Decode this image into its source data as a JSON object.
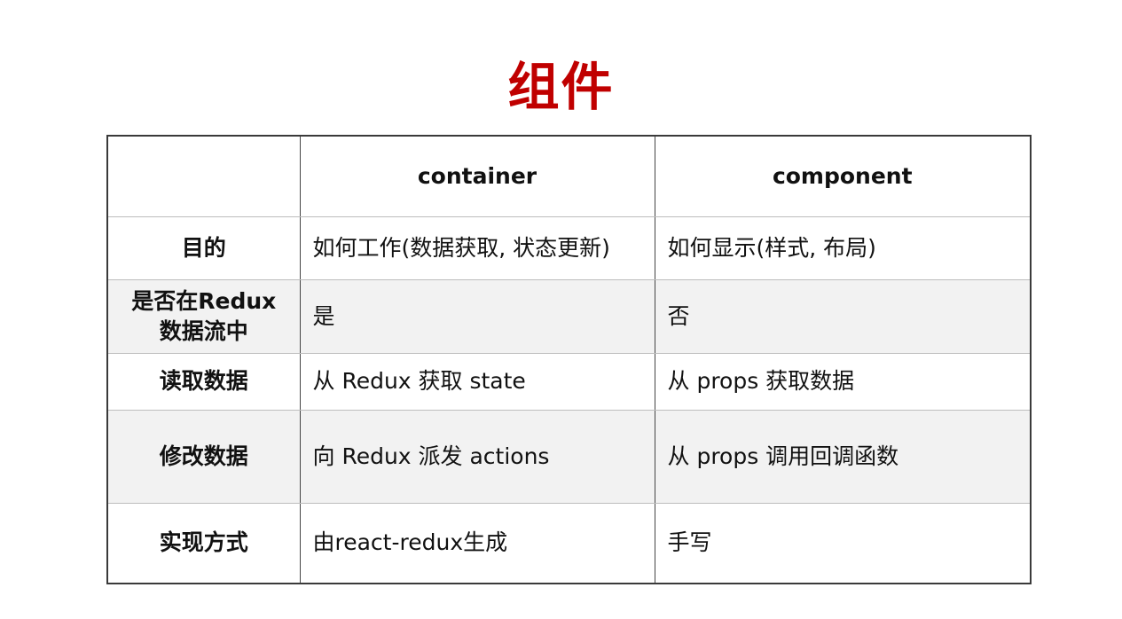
{
  "title": "组件",
  "table": {
    "headers": [
      "",
      "container",
      "component"
    ],
    "rows": [
      {
        "label": "目的",
        "container": "如何工作(数据获取, 状态更新)",
        "component": "如何显示(样式, 布局)"
      },
      {
        "label": "是否在Redux数据流中",
        "container": "是",
        "component": "否"
      },
      {
        "label": "读取数据",
        "container": "从 Redux 获取 state",
        "component": "从 props 获取数据"
      },
      {
        "label": "修改数据",
        "container": "向 Redux 派发 actions",
        "component": "从 props 调用回调函数"
      },
      {
        "label": "实现方式",
        "container": "由react-redux生成",
        "component": "手写"
      }
    ]
  },
  "colors": {
    "title": "#c00000",
    "border": "#3a3a3a",
    "row_shade": "#f2f2f2"
  }
}
